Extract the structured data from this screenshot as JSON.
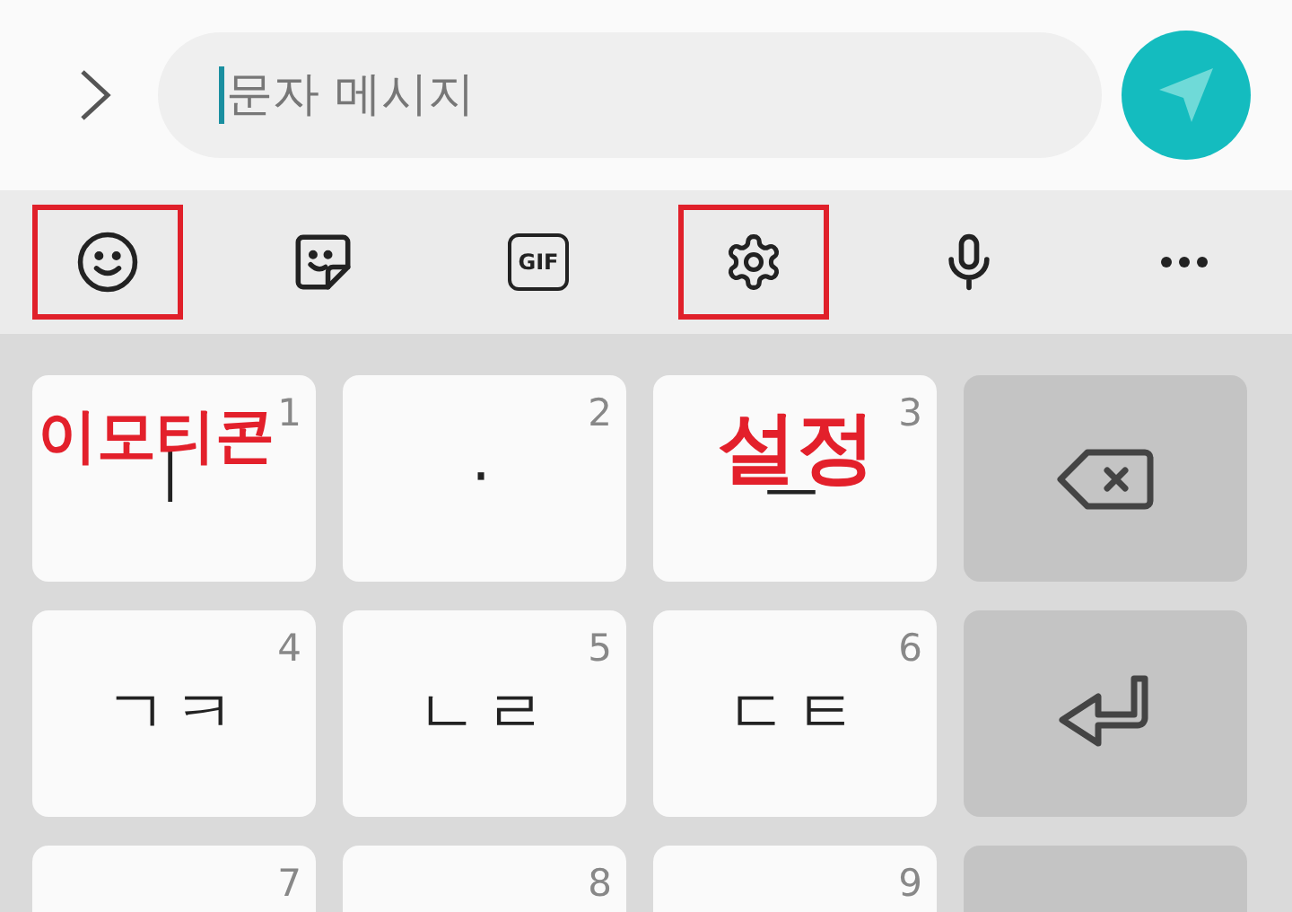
{
  "input": {
    "placeholder": "문자 메시지"
  },
  "toolbar": [
    {
      "kind": "emoji",
      "highlighted": true
    },
    {
      "kind": "sticker",
      "highlighted": false
    },
    {
      "kind": "gif",
      "label": "GIF",
      "highlighted": false
    },
    {
      "kind": "settings",
      "highlighted": true
    },
    {
      "kind": "voice",
      "highlighted": false
    },
    {
      "kind": "more",
      "highlighted": false
    }
  ],
  "keys": [
    [
      {
        "number": "1",
        "char": "ㅣ"
      },
      {
        "number": "2",
        "char": "·"
      },
      {
        "number": "3",
        "char": "ㅡ"
      },
      {
        "kind": "backspace"
      }
    ],
    [
      {
        "number": "4",
        "char": "ㄱㅋ"
      },
      {
        "number": "5",
        "char": "ㄴㄹ"
      },
      {
        "number": "6",
        "char": "ㄷㅌ"
      },
      {
        "kind": "enter"
      }
    ],
    [
      {
        "number": "7"
      },
      {
        "number": "8"
      },
      {
        "number": "9"
      },
      {
        "kind": "blank"
      }
    ]
  ],
  "annotations": [
    {
      "text": "이모티콘"
    },
    {
      "text": "설정"
    }
  ]
}
